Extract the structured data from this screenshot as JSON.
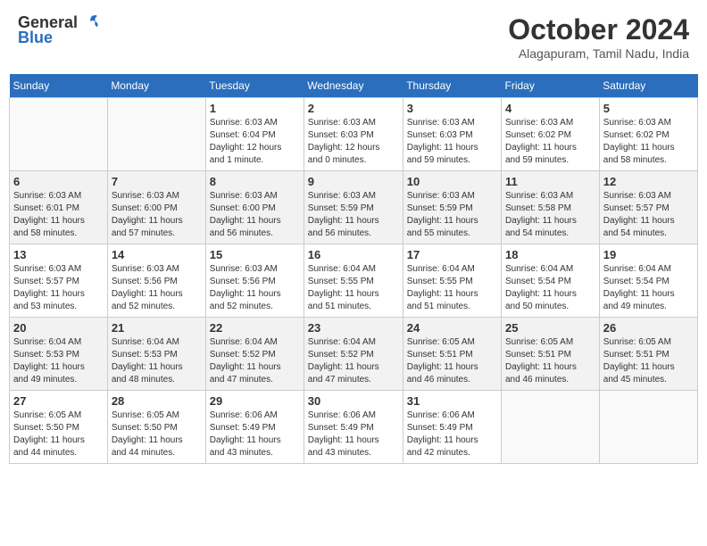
{
  "header": {
    "logo_general": "General",
    "logo_blue": "Blue",
    "month_title": "October 2024",
    "subtitle": "Alagapuram, Tamil Nadu, India"
  },
  "days_of_week": [
    "Sunday",
    "Monday",
    "Tuesday",
    "Wednesday",
    "Thursday",
    "Friday",
    "Saturday"
  ],
  "weeks": [
    [
      {
        "day": "",
        "info": ""
      },
      {
        "day": "",
        "info": ""
      },
      {
        "day": "1",
        "info": "Sunrise: 6:03 AM\nSunset: 6:04 PM\nDaylight: 12 hours\nand 1 minute."
      },
      {
        "day": "2",
        "info": "Sunrise: 6:03 AM\nSunset: 6:03 PM\nDaylight: 12 hours\nand 0 minutes."
      },
      {
        "day": "3",
        "info": "Sunrise: 6:03 AM\nSunset: 6:03 PM\nDaylight: 11 hours\nand 59 minutes."
      },
      {
        "day": "4",
        "info": "Sunrise: 6:03 AM\nSunset: 6:02 PM\nDaylight: 11 hours\nand 59 minutes."
      },
      {
        "day": "5",
        "info": "Sunrise: 6:03 AM\nSunset: 6:02 PM\nDaylight: 11 hours\nand 58 minutes."
      }
    ],
    [
      {
        "day": "6",
        "info": "Sunrise: 6:03 AM\nSunset: 6:01 PM\nDaylight: 11 hours\nand 58 minutes."
      },
      {
        "day": "7",
        "info": "Sunrise: 6:03 AM\nSunset: 6:00 PM\nDaylight: 11 hours\nand 57 minutes."
      },
      {
        "day": "8",
        "info": "Sunrise: 6:03 AM\nSunset: 6:00 PM\nDaylight: 11 hours\nand 56 minutes."
      },
      {
        "day": "9",
        "info": "Sunrise: 6:03 AM\nSunset: 5:59 PM\nDaylight: 11 hours\nand 56 minutes."
      },
      {
        "day": "10",
        "info": "Sunrise: 6:03 AM\nSunset: 5:59 PM\nDaylight: 11 hours\nand 55 minutes."
      },
      {
        "day": "11",
        "info": "Sunrise: 6:03 AM\nSunset: 5:58 PM\nDaylight: 11 hours\nand 54 minutes."
      },
      {
        "day": "12",
        "info": "Sunrise: 6:03 AM\nSunset: 5:57 PM\nDaylight: 11 hours\nand 54 minutes."
      }
    ],
    [
      {
        "day": "13",
        "info": "Sunrise: 6:03 AM\nSunset: 5:57 PM\nDaylight: 11 hours\nand 53 minutes."
      },
      {
        "day": "14",
        "info": "Sunrise: 6:03 AM\nSunset: 5:56 PM\nDaylight: 11 hours\nand 52 minutes."
      },
      {
        "day": "15",
        "info": "Sunrise: 6:03 AM\nSunset: 5:56 PM\nDaylight: 11 hours\nand 52 minutes."
      },
      {
        "day": "16",
        "info": "Sunrise: 6:04 AM\nSunset: 5:55 PM\nDaylight: 11 hours\nand 51 minutes."
      },
      {
        "day": "17",
        "info": "Sunrise: 6:04 AM\nSunset: 5:55 PM\nDaylight: 11 hours\nand 51 minutes."
      },
      {
        "day": "18",
        "info": "Sunrise: 6:04 AM\nSunset: 5:54 PM\nDaylight: 11 hours\nand 50 minutes."
      },
      {
        "day": "19",
        "info": "Sunrise: 6:04 AM\nSunset: 5:54 PM\nDaylight: 11 hours\nand 49 minutes."
      }
    ],
    [
      {
        "day": "20",
        "info": "Sunrise: 6:04 AM\nSunset: 5:53 PM\nDaylight: 11 hours\nand 49 minutes."
      },
      {
        "day": "21",
        "info": "Sunrise: 6:04 AM\nSunset: 5:53 PM\nDaylight: 11 hours\nand 48 minutes."
      },
      {
        "day": "22",
        "info": "Sunrise: 6:04 AM\nSunset: 5:52 PM\nDaylight: 11 hours\nand 47 minutes."
      },
      {
        "day": "23",
        "info": "Sunrise: 6:04 AM\nSunset: 5:52 PM\nDaylight: 11 hours\nand 47 minutes."
      },
      {
        "day": "24",
        "info": "Sunrise: 6:05 AM\nSunset: 5:51 PM\nDaylight: 11 hours\nand 46 minutes."
      },
      {
        "day": "25",
        "info": "Sunrise: 6:05 AM\nSunset: 5:51 PM\nDaylight: 11 hours\nand 46 minutes."
      },
      {
        "day": "26",
        "info": "Sunrise: 6:05 AM\nSunset: 5:51 PM\nDaylight: 11 hours\nand 45 minutes."
      }
    ],
    [
      {
        "day": "27",
        "info": "Sunrise: 6:05 AM\nSunset: 5:50 PM\nDaylight: 11 hours\nand 44 minutes."
      },
      {
        "day": "28",
        "info": "Sunrise: 6:05 AM\nSunset: 5:50 PM\nDaylight: 11 hours\nand 44 minutes."
      },
      {
        "day": "29",
        "info": "Sunrise: 6:06 AM\nSunset: 5:49 PM\nDaylight: 11 hours\nand 43 minutes."
      },
      {
        "day": "30",
        "info": "Sunrise: 6:06 AM\nSunset: 5:49 PM\nDaylight: 11 hours\nand 43 minutes."
      },
      {
        "day": "31",
        "info": "Sunrise: 6:06 AM\nSunset: 5:49 PM\nDaylight: 11 hours\nand 42 minutes."
      },
      {
        "day": "",
        "info": ""
      },
      {
        "day": "",
        "info": ""
      }
    ]
  ]
}
